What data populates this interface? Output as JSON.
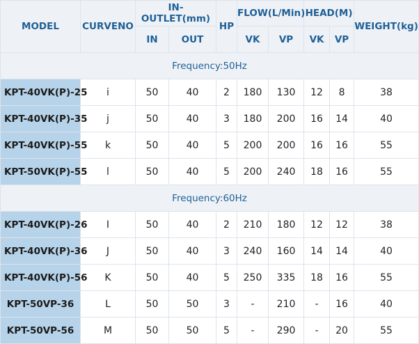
{
  "headers": {
    "model": "MODEL",
    "curveno": "CURVENO",
    "in_outlet": "IN-OUTLET(mm)",
    "hp": "HP",
    "flow": "FLOW(L/Min)",
    "head": "HEAD(M)",
    "weight": "WEIGHT(kg)",
    "in": "IN",
    "out": "OUT",
    "flow_vk": "VK",
    "flow_vp": "VP",
    "head_vk": "VK",
    "head_vp": "VP"
  },
  "groups": [
    {
      "frequency": "Frequency:50Hz",
      "rows": [
        {
          "model": "KPT-40VK(P)-25",
          "curve": "i",
          "in": "50",
          "out": "40",
          "hp": "2",
          "flow_vk": "180",
          "flow_vp": "130",
          "head_vk": "12",
          "head_vp": "8",
          "weight": "38"
        },
        {
          "model": "KPT-40VK(P)-35",
          "curve": "j",
          "in": "50",
          "out": "40",
          "hp": "3",
          "flow_vk": "180",
          "flow_vp": "200",
          "head_vk": "16",
          "head_vp": "14",
          "weight": "40"
        },
        {
          "model": "KPT-40VK(P)-55",
          "curve": "k",
          "in": "50",
          "out": "40",
          "hp": "5",
          "flow_vk": "200",
          "flow_vp": "200",
          "head_vk": "16",
          "head_vp": "16",
          "weight": "55"
        },
        {
          "model": "KPT-50VK(P)-55",
          "curve": "l",
          "in": "50",
          "out": "40",
          "hp": "5",
          "flow_vk": "200",
          "flow_vp": "240",
          "head_vk": "18",
          "head_vp": "16",
          "weight": "55"
        }
      ]
    },
    {
      "frequency": "Frequency:60Hz",
      "rows": [
        {
          "model": "KPT-40VK(P)-26",
          "curve": "I",
          "in": "50",
          "out": "40",
          "hp": "2",
          "flow_vk": "210",
          "flow_vp": "180",
          "head_vk": "12",
          "head_vp": "12",
          "weight": "38"
        },
        {
          "model": "KPT-40VK(P)-36",
          "curve": "J",
          "in": "50",
          "out": "40",
          "hp": "3",
          "flow_vk": "240",
          "flow_vp": "160",
          "head_vk": "14",
          "head_vp": "14",
          "weight": "40"
        },
        {
          "model": "KPT-40VK(P)-56",
          "curve": "K",
          "in": "50",
          "out": "40",
          "hp": "5",
          "flow_vk": "250",
          "flow_vp": "335",
          "head_vk": "18",
          "head_vp": "16",
          "weight": "55"
        },
        {
          "model": "KPT-50VP-36",
          "curve": "L",
          "in": "50",
          "out": "50",
          "hp": "3",
          "flow_vk": "-",
          "flow_vp": "210",
          "head_vk": "-",
          "head_vp": "16",
          "weight": "40"
        },
        {
          "model": "KPT-50VP-56",
          "curve": "M",
          "in": "50",
          "out": "50",
          "hp": "5",
          "flow_vk": "-",
          "flow_vp": "290",
          "head_vk": "-",
          "head_vp": "20",
          "weight": "55"
        }
      ]
    }
  ]
}
